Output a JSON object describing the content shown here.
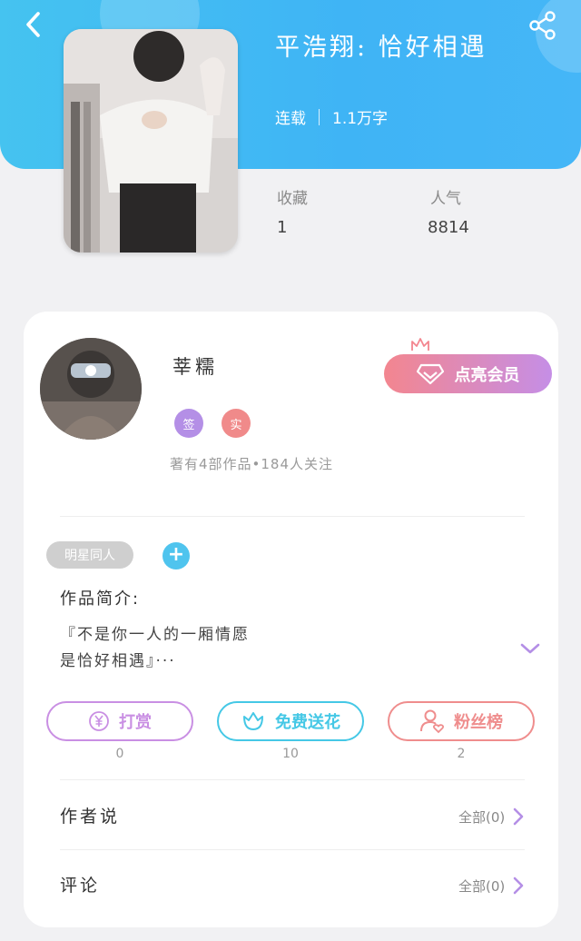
{
  "book": {
    "title": "平浩翔: 恰好相遇",
    "status": "连载",
    "word_count": "1.1万字"
  },
  "stats": {
    "favorites_label": "收藏",
    "favorites_value": "1",
    "popularity_label": "人气",
    "popularity_value": "8814"
  },
  "author": {
    "name": "莘糯",
    "badge_sign": "签",
    "badge_real": "实",
    "description": "著有4部作品•184人关注"
  },
  "vip_button_label": "点亮会员",
  "tag": "明星同人",
  "intro": {
    "label": "作品简介:",
    "line1": "『不是你一人的一厢情愿",
    "line2": "是恰好相遇』···"
  },
  "actions": {
    "reward": {
      "label": "打赏",
      "count": "0"
    },
    "flower": {
      "label": "免费送花",
      "count": "10"
    },
    "fans": {
      "label": "粉丝榜",
      "count": "2"
    }
  },
  "author_says": {
    "label": "作者说",
    "right": "全部(0)"
  },
  "comments": {
    "label": "评论",
    "right": "全部(0)"
  },
  "colors": {
    "header_blue": "#3fb4f5",
    "reward_purple": "#c98fe3",
    "flower_cyan": "#45c8e6",
    "fans_coral": "#ef8d8d",
    "badge_purple": "#b48fe6",
    "badge_coral": "#f08a8a"
  },
  "icons": [
    "back-arrow-icon",
    "share-icon",
    "crown-icon",
    "diamond-icon",
    "plus-icon",
    "chevron-down-icon",
    "yen-icon",
    "flower-icon",
    "user-heart-icon",
    "chevron-right-icon"
  ]
}
